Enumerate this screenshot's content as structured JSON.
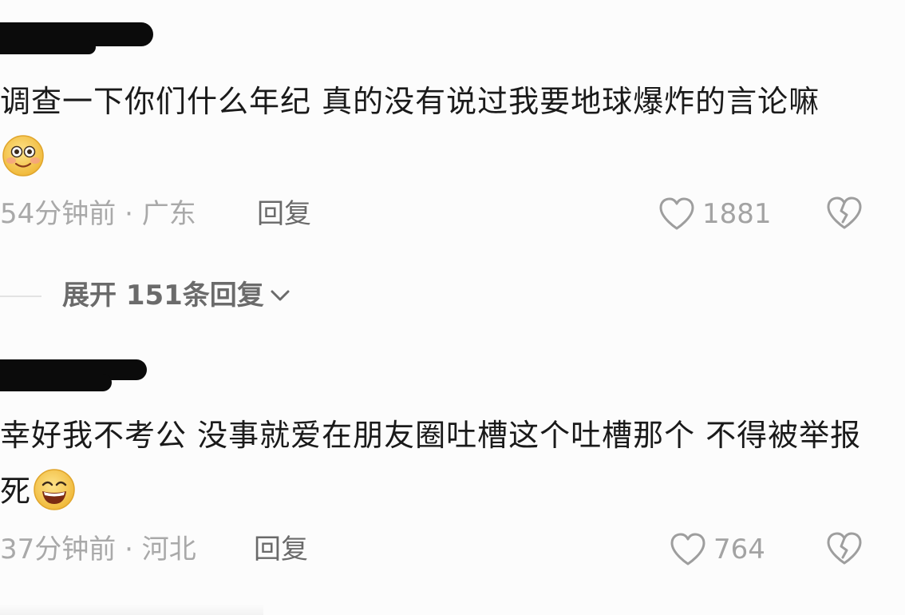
{
  "comments": [
    {
      "text": "调查一下你们什么年纪 真的没有说过我要地球爆炸的言论嘛",
      "emoji": "smiling-emoji",
      "time": "54分钟前",
      "separator": "·",
      "location": "广东",
      "reply_label": "回复",
      "likes": "1881"
    },
    {
      "text": "幸好我不考公 没事就爱在朋友圈吐槽这个吐槽那个 不得被举报死",
      "emoji": "grinning-emoji",
      "time": "37分钟前",
      "separator": "·",
      "location": "河北",
      "reply_label": "回复",
      "likes": "764"
    }
  ],
  "expand_replies": {
    "label": "展开 151条回复"
  },
  "icons": {
    "like": "heart-outline-icon",
    "dislike": "broken-heart-icon",
    "expand": "chevron-down-icon"
  },
  "colors": {
    "background": "#fcfcfc",
    "text": "#1a1a1a",
    "meta": "#a9a9a9",
    "emoji_face": "#f5c542"
  }
}
